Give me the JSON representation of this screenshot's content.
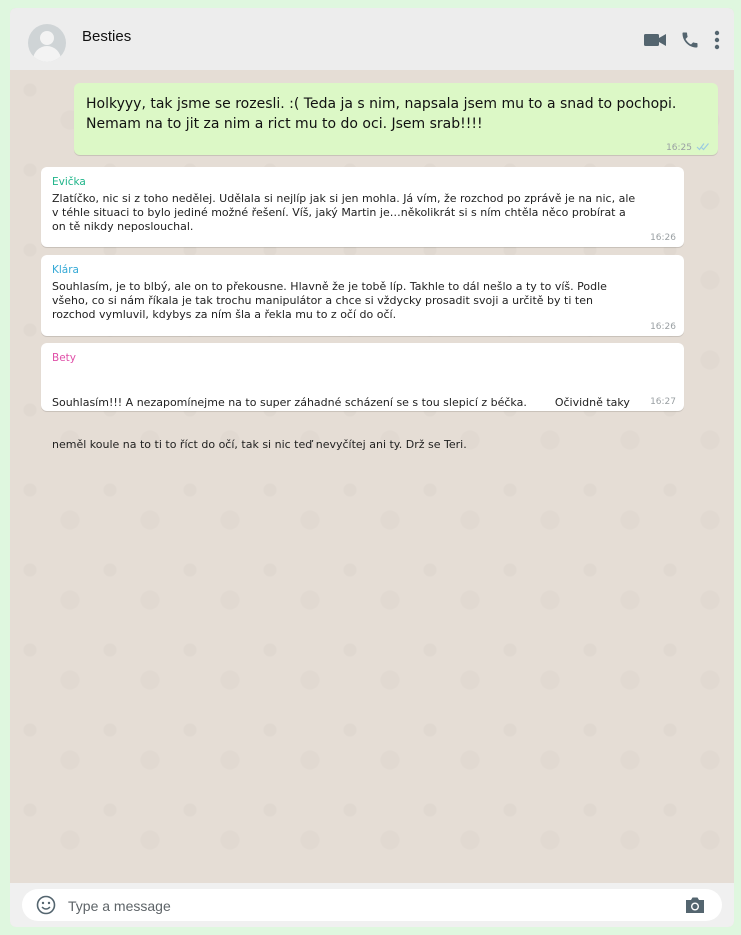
{
  "header": {
    "title": "Besties",
    "icons": [
      "avatar-placeholder",
      "video-call-icon",
      "phone-icon",
      "more-vert-icon"
    ]
  },
  "messages": [
    {
      "direction": "out",
      "text_line1": "Holkyyy, tak jsme se rozesli. :( Teda ja s nim, napsala jsem mu to a snad to pochopi.",
      "text_line2": "Nemam na to jit za nim a rict mu to do oci. Jsem srab!!!!",
      "time": "16:25"
    },
    {
      "direction": "in",
      "sender": "Evička",
      "sender_color": "#1fb58a",
      "lines": [
        "Zlatíčko, nic si z toho nedělej. Udělala si nejlíp jak si jen mohla. Já vím, že rozchod po zprávě je na nic, ale",
        "v téhle situaci to bylo jediné možné řešení. Víš, jaký Martin je…několikrát si s ním chtěla něco probírat a",
        "on tě nikdy neposlouchal."
      ],
      "time": "16:26"
    },
    {
      "direction": "in",
      "sender": "Klára",
      "sender_color": "#35a9d6",
      "lines": [
        "Souhlasím, je to blbý, ale on to překousne. Hlavně že je tobě líp. Takhle to dál nešlo a ty to víš. Podle",
        "všeho, co si nám říkala je tak trochu manipulátor a chce si vždycky prosadit svoji a určitě by ti ten",
        "rozchod vymluvil, kdybys za ním šla a řekla mu to z očí do očí."
      ],
      "time": "16:26"
    },
    {
      "direction": "in",
      "sender": "Bety",
      "sender_color": "#e04fa8",
      "lines": [
        "Souhlasím!!! A nezapomínejme na to super záhadné scházení se s tou slepicí z béčka.        Očividně taky",
        "neměl koule na to ti to říct do očí, tak si nic teď nevyčítej ani ty. Drž se Teri."
      ],
      "time": "16:27"
    }
  ],
  "composer": {
    "placeholder": "Type a message",
    "icons": [
      "emoji-icon",
      "camera-icon"
    ]
  },
  "colors": {
    "outgoing_bubble": "#dcf8c6",
    "incoming_bubble": "#ffffff",
    "wallpaper": "#e5ddd5",
    "read_ticks": "#4fc3f7"
  }
}
